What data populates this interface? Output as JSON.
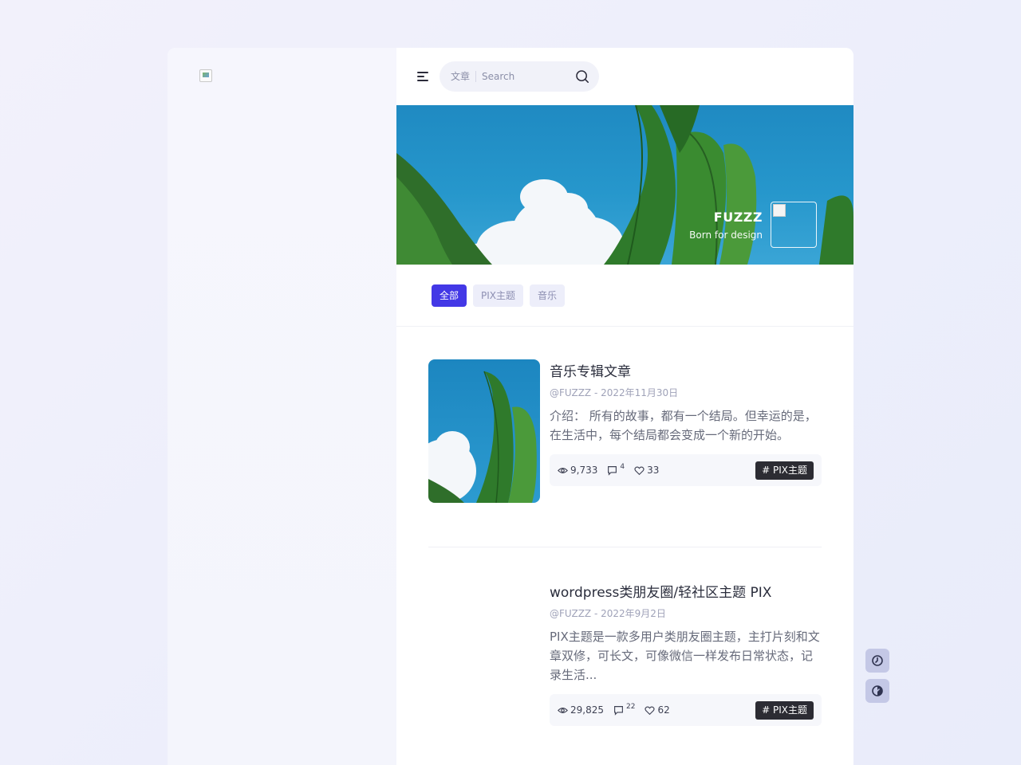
{
  "header": {
    "search_type": "文章",
    "search_placeholder": "Search"
  },
  "banner": {
    "name": "FUZZZ",
    "tagline": "Born for design"
  },
  "tabs": [
    {
      "label": "全部",
      "active": true
    },
    {
      "label": "PIX主题",
      "active": false
    },
    {
      "label": "音乐",
      "active": false
    }
  ],
  "posts": [
    {
      "title": "音乐专辑文章",
      "meta": "@FUZZZ - 2022年11月30日",
      "excerpt": "介绍： 所有的故事，都有一个结局。但幸运的是，在生活中，每个结局都会变成一个新的开始。",
      "views": "9,733",
      "comments": "4",
      "likes": "33",
      "tag": "# PIX主题"
    },
    {
      "title": "wordpress类朋友圈/轻社区主题 PIX",
      "meta": "@FUZZZ - 2022年9月2日",
      "excerpt": "PIX主题是一款多用户类朋友圈主题，主打片刻和文章双修，可长文，可像微信一样发布日常状态，记录生活...",
      "views": "29,825",
      "comments": "22",
      "likes": "62",
      "tag": "# PIX主题"
    }
  ],
  "colors": {
    "accent": "#4338e6",
    "tag_bg": "#2c2c33"
  }
}
